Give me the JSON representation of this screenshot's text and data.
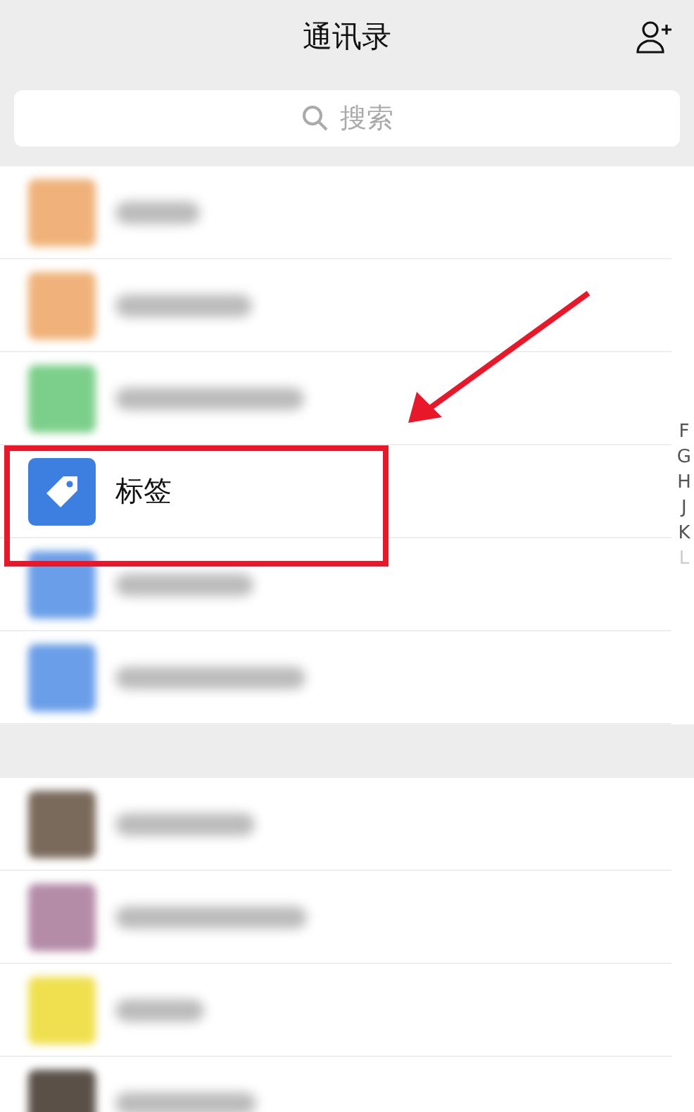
{
  "header": {
    "title": "通讯录"
  },
  "search": {
    "placeholder": "搜索"
  },
  "rows": [
    {
      "kind": "blurred",
      "color": "#f0b27a"
    },
    {
      "kind": "blurred",
      "color": "#f0b27a"
    },
    {
      "kind": "blurred",
      "color": "#7ccf8a"
    },
    {
      "kind": "tag",
      "label": "标签",
      "color": "#3d7fe0"
    },
    {
      "kind": "blurred",
      "color": "#6a9ee8"
    },
    {
      "kind": "blurred",
      "color": "#6a9ee8"
    },
    {
      "kind": "section"
    },
    {
      "kind": "blurred",
      "color": "#7a6a5c"
    },
    {
      "kind": "blurred",
      "color": "#b48ca8"
    },
    {
      "kind": "blurred",
      "color": "#f0e050"
    },
    {
      "kind": "blurred",
      "color": "#5a5048"
    }
  ],
  "index": [
    "F",
    "G",
    "H",
    "J",
    "K",
    "L"
  ]
}
